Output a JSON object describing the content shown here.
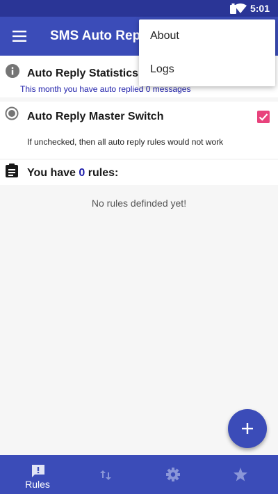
{
  "status_bar": {
    "time": "5:01",
    "icons": [
      "wifi-icon",
      "battery-icon"
    ]
  },
  "app_bar": {
    "title": "SMS Auto Reply",
    "menu_icon": "menu-icon"
  },
  "stats": {
    "title": "Auto Reply Statistics",
    "subtitle": "This month you have auto replied 0 messages",
    "icon": "info-icon"
  },
  "master_switch": {
    "title": "Auto Reply Master Switch",
    "description": "If unchecked, then all auto reply rules would not work",
    "checked": true,
    "icon": "radio-icon"
  },
  "rules": {
    "prefix": "You have ",
    "count": "0",
    "suffix": " rules:",
    "empty_message": "No rules definded yet!",
    "icon": "clipboard-icon"
  },
  "fab": {
    "icon": "add-icon"
  },
  "bottom_nav": {
    "items": [
      {
        "label": "Rules",
        "icon": "rules-feedback-icon",
        "active": true
      },
      {
        "label": "",
        "icon": "transfer-arrows-icon"
      },
      {
        "label": "",
        "icon": "gear-icon"
      },
      {
        "label": "",
        "icon": "star-icon"
      }
    ]
  },
  "overflow_menu": {
    "items": [
      "About",
      "Logs"
    ]
  },
  "colors": {
    "primary": "#3b4cb8",
    "status_bar": "#2a3596",
    "accent": "#e8427c",
    "link_blue": "#1a1aa8"
  }
}
